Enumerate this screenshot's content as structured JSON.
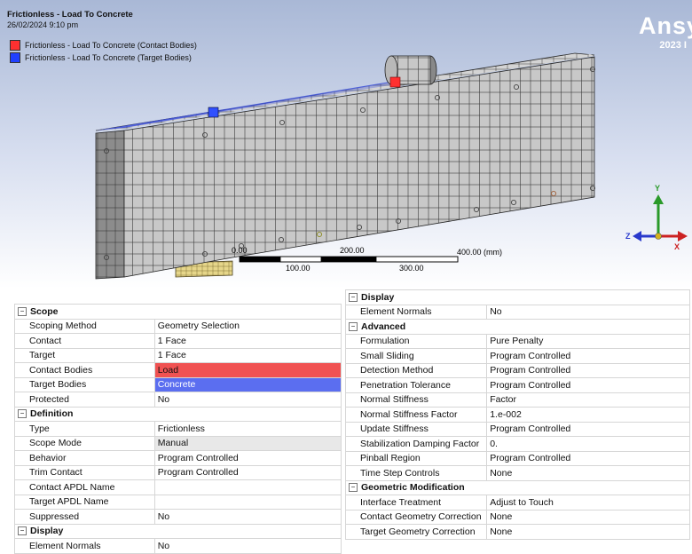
{
  "viewport": {
    "title": "Frictionless - Load To Concrete",
    "timestamp": "26/02/2024 9:10 pm",
    "legend": [
      {
        "label": "Frictionless - Load To Concrete (Contact Bodies)",
        "color": "#ff3030"
      },
      {
        "label": "Frictionless - Load To Concrete (Target Bodies)",
        "color": "#2040ff"
      }
    ],
    "brand": "Ansy",
    "version": "2023 I",
    "scale_bar": {
      "top_labels": [
        "0.00",
        "200.00",
        "400.00 (mm)"
      ],
      "bottom_labels": [
        "100.00",
        "300.00"
      ]
    },
    "triad": {
      "x": "X",
      "y": "Y",
      "z": "Z"
    }
  },
  "colors": {
    "mesh": "#c8c8c8",
    "contact": "#f05252",
    "target": "#5b6ef0"
  },
  "left_table": {
    "sections": [
      {
        "title": "Scope",
        "rows": [
          {
            "name": "Scoping Method",
            "value": "Geometry Selection"
          },
          {
            "name": "Contact",
            "value": "1 Face"
          },
          {
            "name": "Target",
            "value": "1 Face"
          },
          {
            "name": "Contact Bodies",
            "value": "Load",
            "style": "load"
          },
          {
            "name": "Target Bodies",
            "value": "Concrete",
            "style": "target"
          },
          {
            "name": "Protected",
            "value": "No"
          }
        ]
      },
      {
        "title": "Definition",
        "rows": [
          {
            "name": "Type",
            "value": "Frictionless"
          },
          {
            "name": "Scope Mode",
            "value": "Manual",
            "style": "grey"
          },
          {
            "name": "Behavior",
            "value": "Program Controlled"
          },
          {
            "name": "Trim Contact",
            "value": "Program Controlled"
          },
          {
            "name": "Contact APDL Name",
            "value": ""
          },
          {
            "name": "Target APDL Name",
            "value": ""
          },
          {
            "name": "Suppressed",
            "value": "No"
          }
        ]
      },
      {
        "title": "Display",
        "rows": [
          {
            "name": "Element Normals",
            "value": "No"
          }
        ]
      }
    ]
  },
  "right_table": {
    "sections": [
      {
        "title": "Display",
        "rows": [
          {
            "name": "Element Normals",
            "value": "No"
          }
        ]
      },
      {
        "title": "Advanced",
        "rows": [
          {
            "name": "Formulation",
            "value": "Pure Penalty"
          },
          {
            "name": "Small Sliding",
            "value": "Program Controlled"
          },
          {
            "name": "Detection Method",
            "value": "Program Controlled"
          },
          {
            "name": "Penetration Tolerance",
            "value": "Program Controlled"
          },
          {
            "name": "Normal Stiffness",
            "value": "Factor"
          },
          {
            "name": "Normal Stiffness Factor",
            "value": "1.e-002"
          },
          {
            "name": "Update Stiffness",
            "value": "Program Controlled"
          },
          {
            "name": "Stabilization Damping Factor",
            "value": "0."
          },
          {
            "name": "Pinball Region",
            "value": "Program Controlled"
          },
          {
            "name": "Time Step Controls",
            "value": "None"
          }
        ]
      },
      {
        "title": "Geometric Modification",
        "rows": [
          {
            "name": "Interface Treatment",
            "value": "Adjust to Touch"
          },
          {
            "name": "Contact Geometry Correction",
            "value": "None"
          },
          {
            "name": "Target Geometry Correction",
            "value": "None"
          }
        ]
      }
    ]
  }
}
